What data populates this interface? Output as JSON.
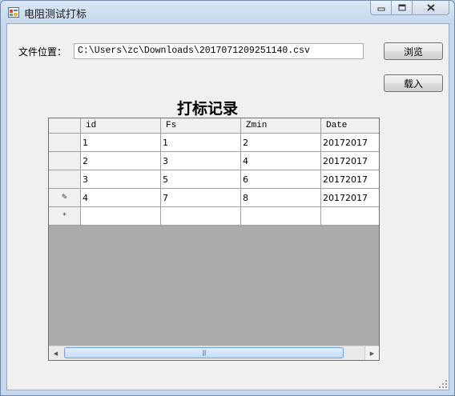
{
  "window": {
    "title": "电阻测试打标",
    "icon": "app-window-icon",
    "caption": {
      "minimize_glyph": "▭",
      "maximize_glyph": "□",
      "close_glyph": "✕"
    }
  },
  "form": {
    "file_label": "文件位置：",
    "file_path": "C:\\Users\\zc\\Downloads\\2017071209251140.csv",
    "browse_label": "浏览",
    "load_label": "载入",
    "grid_title": "打标记录"
  },
  "grid": {
    "columns": [
      "id",
      "Fs",
      "Zmin",
      "Date"
    ],
    "rows": [
      [
        "1",
        "1",
        "2",
        "20172017"
      ],
      [
        "2",
        "3",
        "4",
        "20172017"
      ],
      [
        "3",
        "5",
        "6",
        "20172017"
      ],
      [
        "4",
        "7",
        "8",
        "20172017"
      ]
    ],
    "editing_row_glyph": "✎",
    "new_row_glyph": "*"
  },
  "scrollbar": {
    "left_arrow": "◀",
    "right_arrow": "▶",
    "thumb_grip": "|||"
  }
}
